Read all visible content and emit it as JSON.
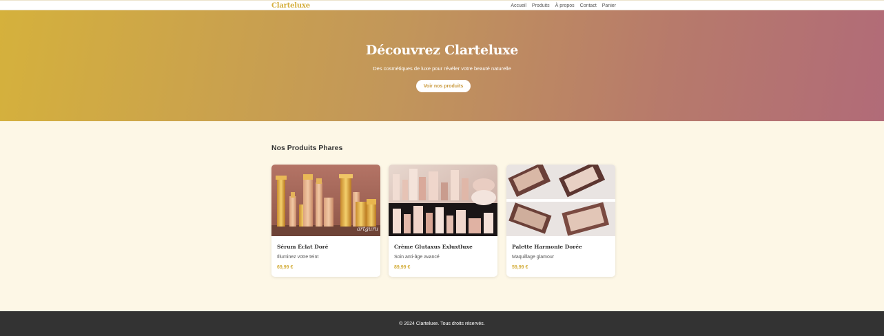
{
  "nav": {
    "logo": "Clarteluxe",
    "links": [
      "Accueil",
      "Produits",
      "À propos",
      "Contact",
      "Panier"
    ]
  },
  "hero": {
    "title": "Découvrez Clarteluxe",
    "subtitle": "Des cosmétiques de luxe pour révéler votre beauté naturelle",
    "cta": "Voir nos produits"
  },
  "featured": {
    "title": "Nos Produits Phares",
    "products": [
      {
        "name": "Sérum Éclat Doré",
        "description": "Illuminez votre teint",
        "price": "69,99 €",
        "watermark": "artguru"
      },
      {
        "name": "Crème Glutaxus Exluxtluxe",
        "description": "Soin anti-âge avancé",
        "price": "89,99 €"
      },
      {
        "name": "Palette Harmonie Dorée",
        "description": "Maquillage glamour",
        "price": "59,99 €"
      }
    ]
  },
  "footer": {
    "text": "© 2024 Clarteluxe. Tous droits réservés."
  },
  "colors": {
    "gold": "#d4ae3d",
    "gradient_start": "#d5b13c",
    "gradient_end": "#b16b78",
    "page_bg": "#fdf7e6",
    "footer_bg": "#333333"
  }
}
